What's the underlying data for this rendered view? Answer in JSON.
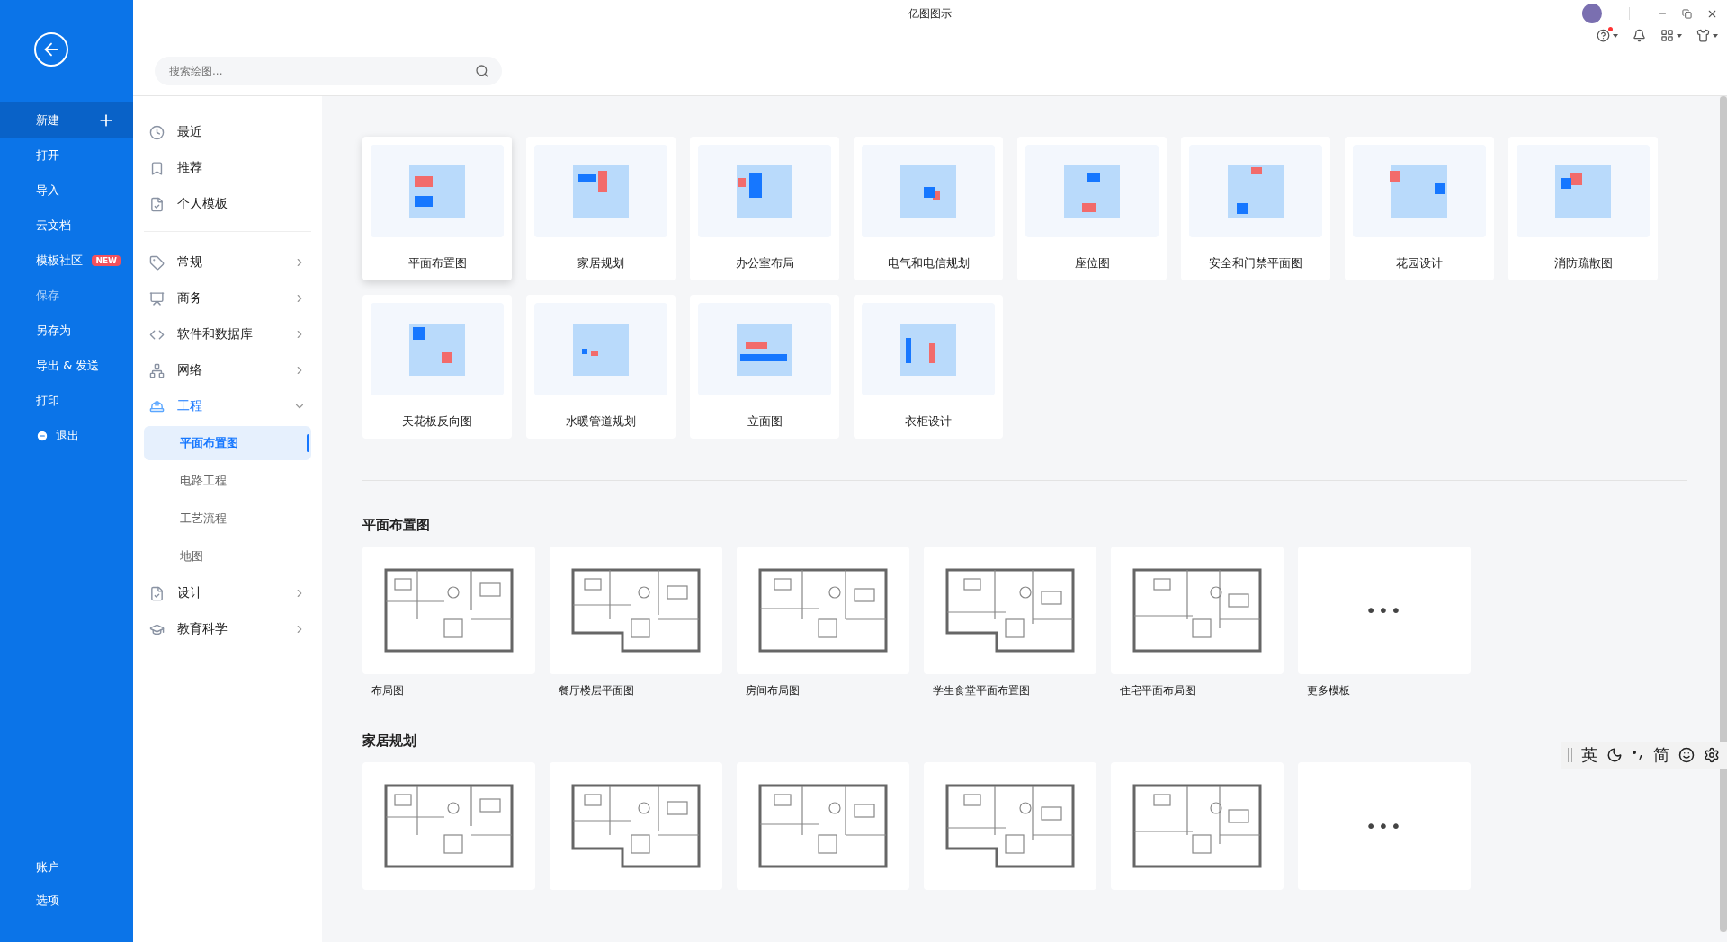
{
  "window": {
    "title": "亿图图示"
  },
  "search": {
    "placeholder": "搜索绘图..."
  },
  "sidebar": {
    "items": [
      {
        "label": "新建",
        "kind": "new",
        "selected": true,
        "disabled": false
      },
      {
        "label": "打开",
        "kind": "plain",
        "selected": false,
        "disabled": false
      },
      {
        "label": "导入",
        "kind": "plain",
        "selected": false,
        "disabled": false
      },
      {
        "label": "云文档",
        "kind": "plain",
        "selected": false,
        "disabled": false
      },
      {
        "label": "模板社区",
        "kind": "plain",
        "badge": "NEW",
        "selected": false,
        "disabled": false
      },
      {
        "label": "保存",
        "kind": "plain",
        "selected": false,
        "disabled": true
      },
      {
        "label": "另存为",
        "kind": "plain",
        "selected": false,
        "disabled": false
      },
      {
        "label": "导出 & 发送",
        "kind": "plain",
        "selected": false,
        "disabled": false
      },
      {
        "label": "打印",
        "kind": "plain",
        "selected": false,
        "disabled": false
      },
      {
        "label": "退出",
        "kind": "exit",
        "selected": false,
        "disabled": false
      }
    ],
    "bottom_items": [
      {
        "label": "账户"
      },
      {
        "label": "选项"
      }
    ]
  },
  "nav": {
    "quick": [
      {
        "label": "最近",
        "kind": "clock"
      },
      {
        "label": "推荐",
        "kind": "bookmark"
      },
      {
        "label": "个人模板",
        "kind": "doc"
      }
    ],
    "categories": [
      {
        "label": "常规",
        "kind": "tag",
        "expanded": false
      },
      {
        "label": "商务",
        "kind": "board",
        "expanded": false
      },
      {
        "label": "软件和数据库",
        "kind": "code",
        "expanded": false
      },
      {
        "label": "网络",
        "kind": "net",
        "expanded": false
      },
      {
        "label": "工程",
        "kind": "helmet",
        "expanded": true,
        "children": [
          {
            "label": "平面布置图",
            "selected": true
          },
          {
            "label": "电路工程",
            "selected": false
          },
          {
            "label": "工艺流程",
            "selected": false
          },
          {
            "label": "地图",
            "selected": false
          }
        ]
      },
      {
        "label": "设计",
        "kind": "doc",
        "expanded": false
      },
      {
        "label": "教育科学",
        "kind": "cap",
        "expanded": false
      }
    ]
  },
  "category_cards": [
    {
      "label": "平面布置图",
      "selected": true
    },
    {
      "label": "家居规划",
      "selected": false
    },
    {
      "label": "办公室布局",
      "selected": false
    },
    {
      "label": "电气和电信规划",
      "selected": false
    },
    {
      "label": "座位图",
      "selected": false
    },
    {
      "label": "安全和门禁平面图",
      "selected": false
    },
    {
      "label": "花园设计",
      "selected": false
    },
    {
      "label": "消防疏散图",
      "selected": false
    },
    {
      "label": "天花板反向图",
      "selected": false
    },
    {
      "label": "水暖管道规划",
      "selected": false
    },
    {
      "label": "立面图",
      "selected": false
    },
    {
      "label": "衣柜设计",
      "selected": false
    }
  ],
  "sections": [
    {
      "title": "平面布置图",
      "templates": [
        {
          "kind": "template",
          "label": "布局图"
        },
        {
          "kind": "template",
          "label": "餐厅楼层平面图"
        },
        {
          "kind": "template",
          "label": "房间布局图"
        },
        {
          "kind": "template",
          "label": "学生食堂平面布置图"
        },
        {
          "kind": "template",
          "label": "住宅平面布局图"
        },
        {
          "kind": "more",
          "symbol": "•••",
          "label": "更多模板"
        }
      ]
    },
    {
      "title": "家居规划",
      "templates": [
        {
          "kind": "template"
        },
        {
          "kind": "template"
        },
        {
          "kind": "template"
        },
        {
          "kind": "template"
        },
        {
          "kind": "template"
        },
        {
          "kind": "more",
          "symbol": "•••"
        }
      ]
    }
  ],
  "ime_toolbar": {
    "language": "英",
    "script": "简"
  }
}
